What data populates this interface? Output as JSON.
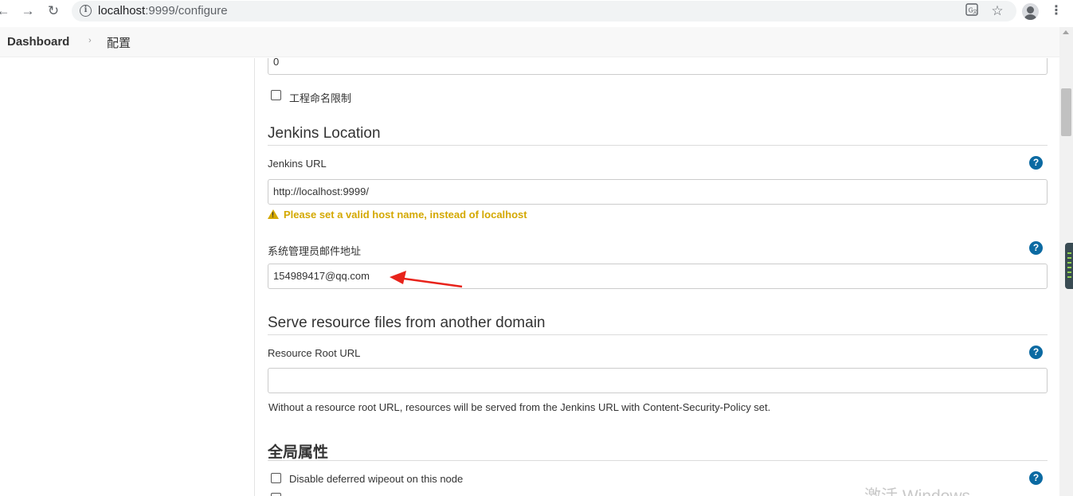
{
  "browser": {
    "url_host": "localhost",
    "url_path": ":9999/configure",
    "icons": [
      "back-icon",
      "forward-icon",
      "reload-icon",
      "info-icon",
      "translate-icon",
      "star-icon",
      "profile-icon",
      "menu-icon"
    ]
  },
  "breadcrumb": {
    "dashboard": "Dashboard",
    "separator": "›",
    "current": "配置"
  },
  "form": {
    "top_input_value": "0",
    "project_naming": {
      "label": "工程命名限制",
      "checked": false
    },
    "jenkins_location": {
      "title": "Jenkins Location",
      "url_label": "Jenkins URL",
      "url_value": "http://localhost:9999/",
      "warning": "Please set a valid host name, instead of localhost",
      "email_label": "系统管理员邮件地址",
      "email_value": "154989417@qq.com"
    },
    "resource_domain": {
      "title": "Serve resource files from another domain",
      "root_url_label": "Resource Root URL",
      "root_url_value": "",
      "description": "Without a resource root URL, resources will be served from the Jenkins URL with Content-Security-Policy set."
    },
    "global_properties": {
      "title": "全局属性",
      "disable_wipeout_label": "Disable deferred wipeout on this node",
      "disable_wipeout_checked": false
    },
    "help_symbol": "?"
  },
  "watermark": "激活 Windows",
  "annotation_color": "#e8231b",
  "warning_color": "#d4a800",
  "help_icon_color": "#0b6aa2"
}
